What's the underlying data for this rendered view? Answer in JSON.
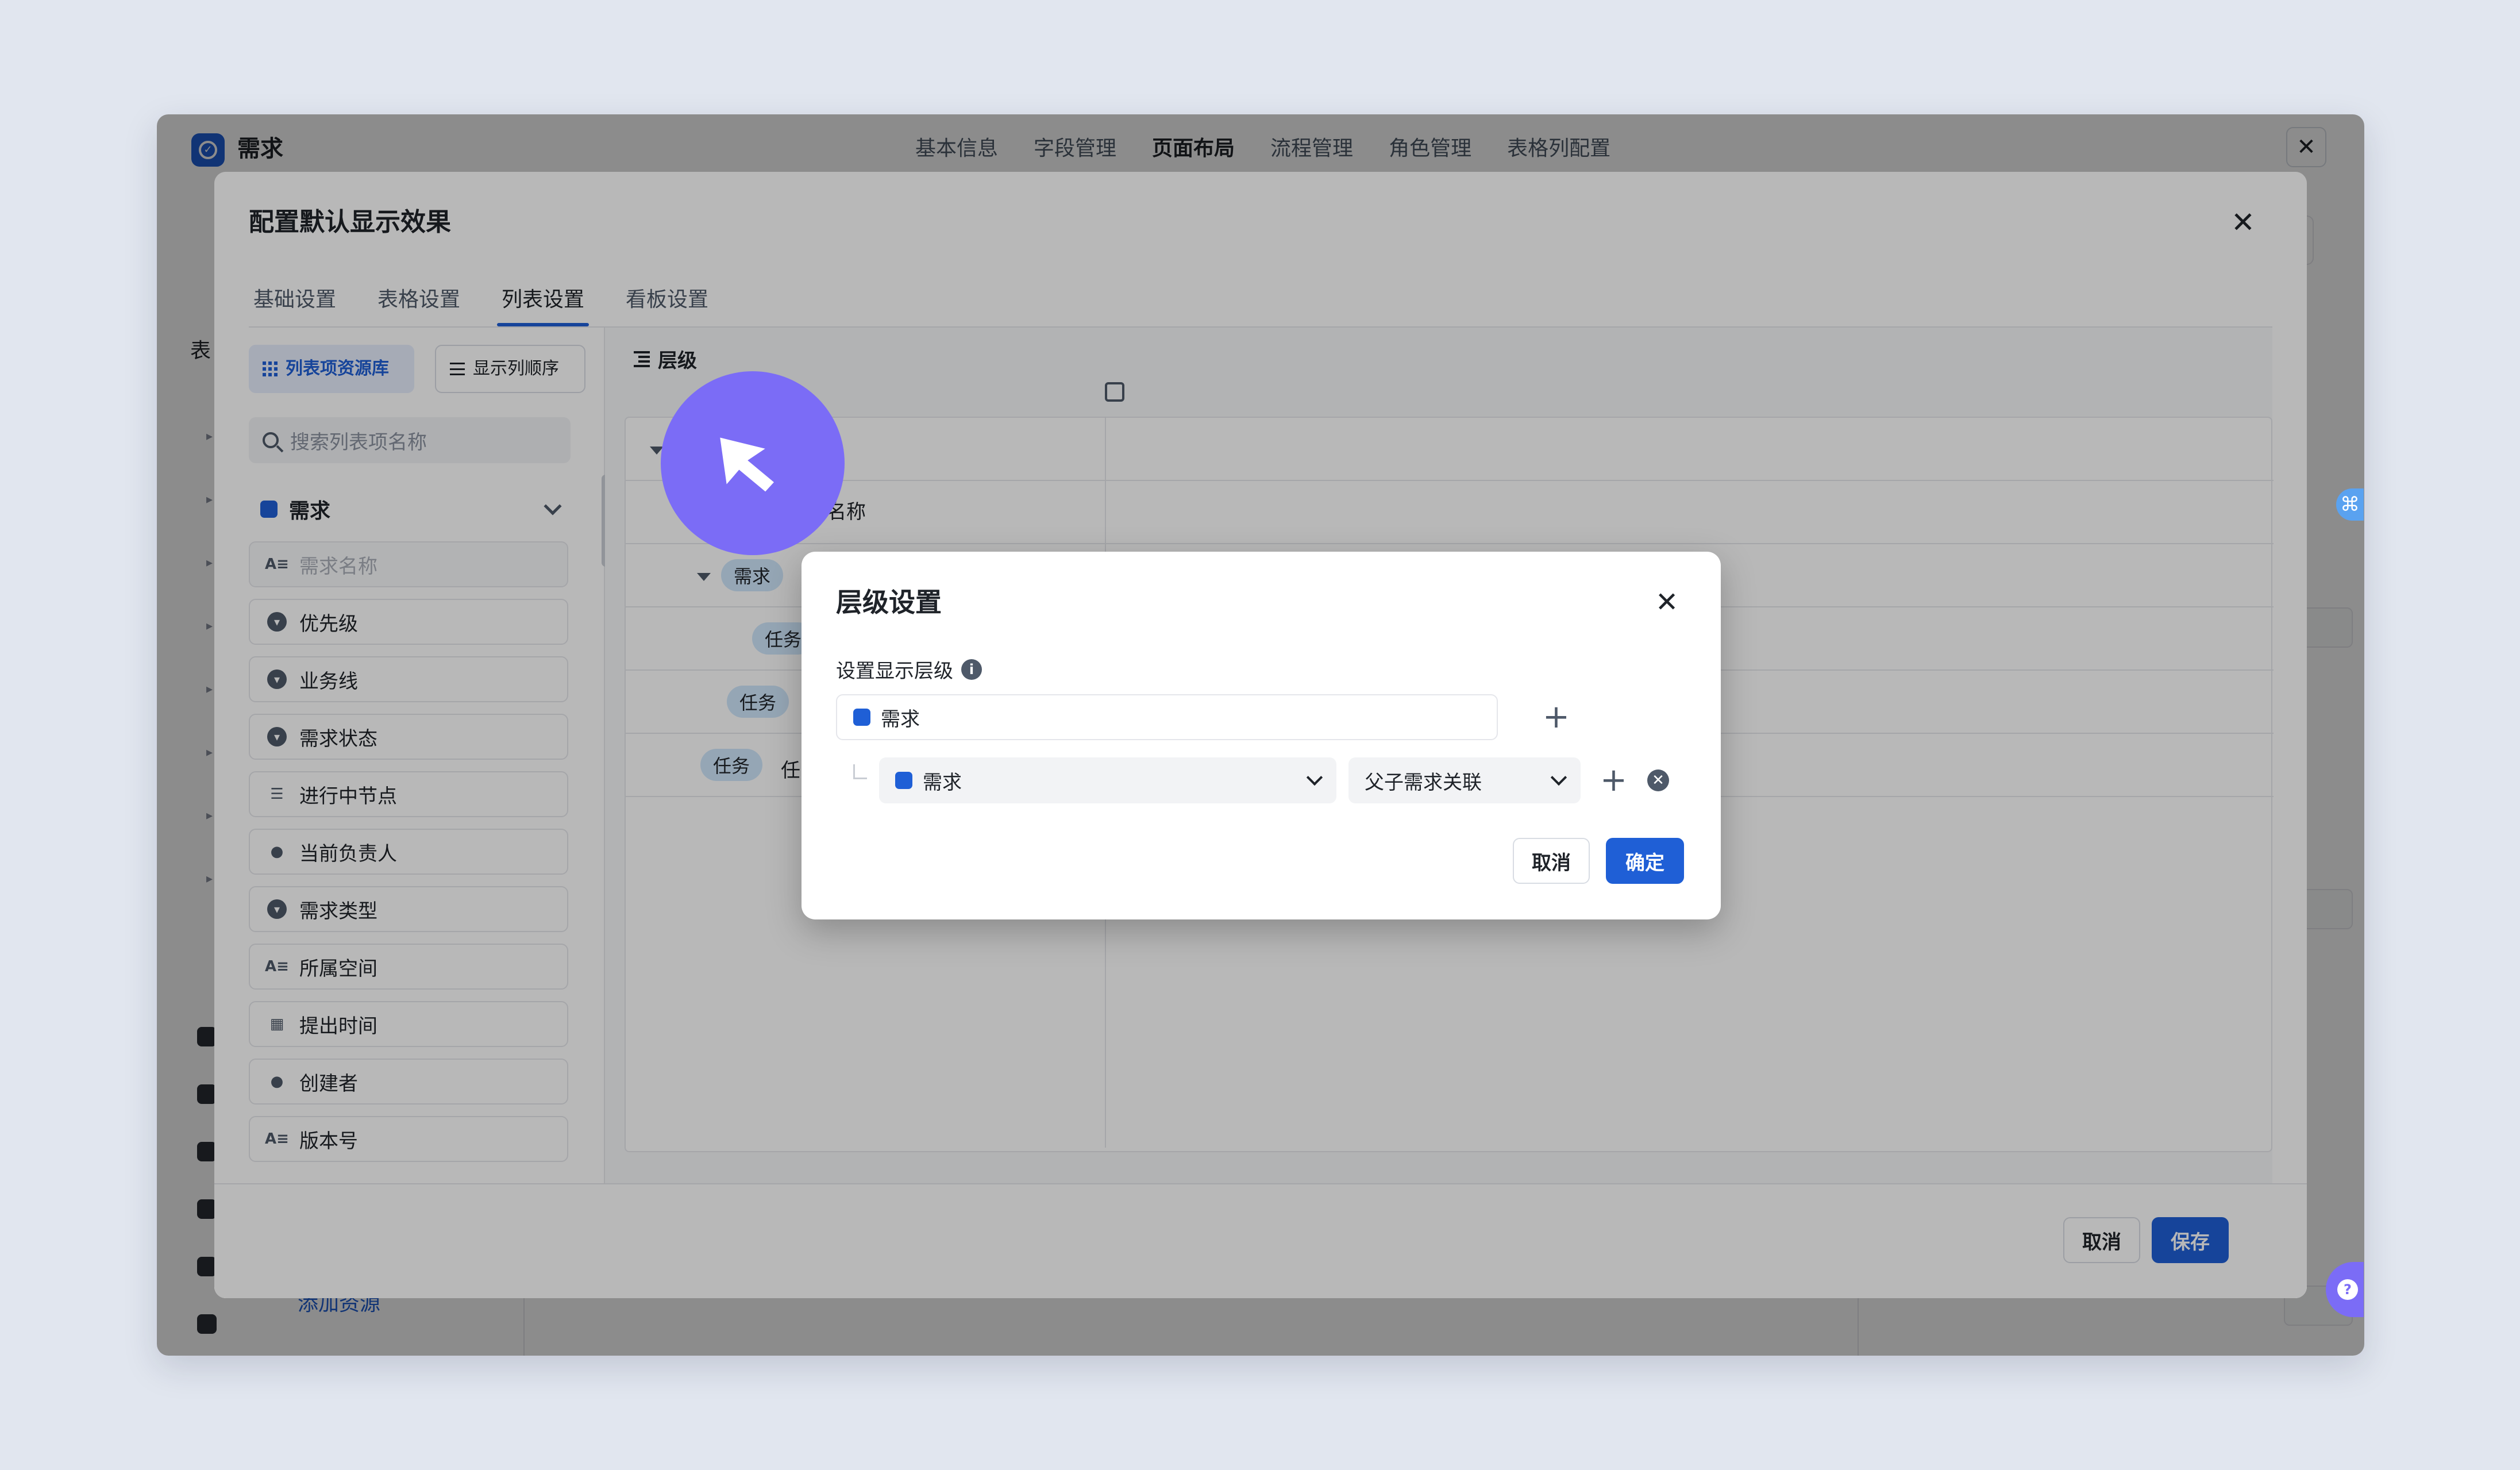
{
  "app": {
    "title": "需求",
    "nav": [
      "基本信息",
      "字段管理",
      "页面布局",
      "流程管理",
      "角色管理",
      "表格列配置"
    ],
    "nav_active_index": 2,
    "close_glyph": "✕",
    "bg_left_heading": "表",
    "bg_add_link": "添加资源"
  },
  "config_modal": {
    "title": "配置默认显示效果",
    "close_glyph": "✕",
    "tabs": [
      "基础设置",
      "表格设置",
      "列表设置",
      "看板设置"
    ],
    "active_tab_index": 2,
    "left_panel": {
      "library_button": "列表项资源库",
      "order_button": "显示列顺序",
      "search_placeholder": "搜索列表项名称",
      "group_label": "需求",
      "items": [
        {
          "label": "需求名称",
          "icon": "text-field-icon",
          "disabled": true
        },
        {
          "label": "优先级",
          "icon": "select-field-icon"
        },
        {
          "label": "业务线",
          "icon": "select-field-icon"
        },
        {
          "label": "需求状态",
          "icon": "select-field-icon"
        },
        {
          "label": "进行中节点",
          "icon": "node-field-icon"
        },
        {
          "label": "当前负责人",
          "icon": "person-field-icon"
        },
        {
          "label": "需求类型",
          "icon": "select-field-icon"
        },
        {
          "label": "所属空间",
          "icon": "text-field-icon"
        },
        {
          "label": "提出时间",
          "icon": "calendar-field-icon"
        },
        {
          "label": "创建者",
          "icon": "person-field-icon"
        },
        {
          "label": "版本号",
          "icon": "text-field-icon"
        }
      ]
    },
    "right_panel": {
      "heading": "层级",
      "name_header_fragment": "名称",
      "tags": {
        "story": "需求",
        "task_a": "任务",
        "task_b": "任务",
        "task_c": "任务"
      },
      "task_text_fragment": "任"
    },
    "footer": {
      "cancel": "取消",
      "save": "保存"
    }
  },
  "hierarchy_dialog": {
    "title": "层级设置",
    "close_glyph": "✕",
    "label": "设置显示层级",
    "info_glyph": "i",
    "level1_value": "需求",
    "level2_value": "需求",
    "level2_relation": "父子需求关联",
    "add_glyph": "+",
    "remove_glyph": "✕",
    "cancel": "取消",
    "confirm": "确定"
  },
  "badges": {
    "help_glyph": "?",
    "command_glyph": "⌘"
  },
  "colors": {
    "accent": "#1f5fd6",
    "cursor": "#7b6cf6",
    "tag": "#cfe6fb",
    "page_bg": "#e1e6ef"
  }
}
